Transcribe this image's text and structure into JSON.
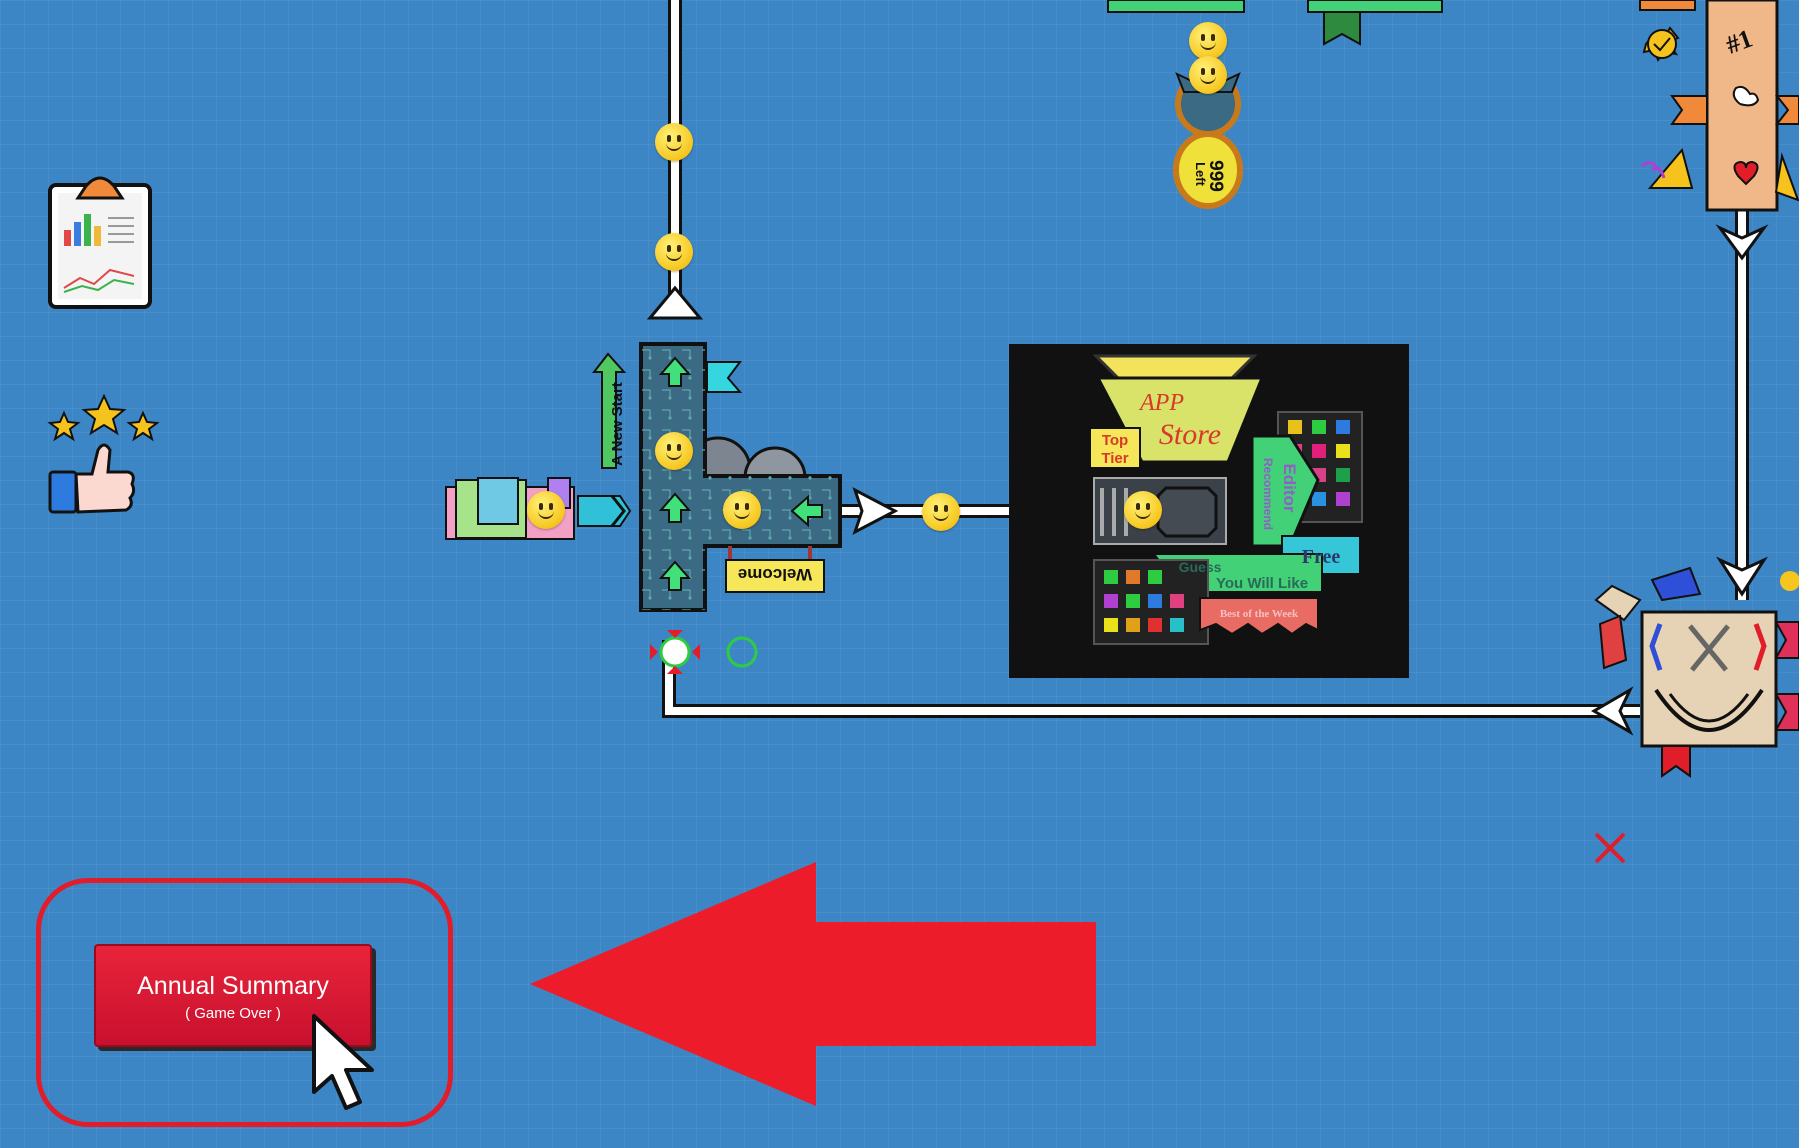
{
  "summary_button": {
    "title": "Annual Summary",
    "subtitle": "( Game Over )"
  },
  "app_store": {
    "name_line1": "APP",
    "name_line2": "Store",
    "tag_top_tier_1": "Top",
    "tag_top_tier_2": "Tier",
    "tag_editor": "Editor",
    "tag_recommend": "Recommend",
    "tag_free": "Free",
    "tag_guess": "Guess",
    "tag_you_will_like": "You Will Like",
    "tag_best_week": "Best of the Week"
  },
  "hub": {
    "new_start_label": "A New Start",
    "welcome_label": "Welcome"
  },
  "counter": {
    "value": "999",
    "unit": "Left"
  },
  "ranking": {
    "label": "#1"
  },
  "icons": [
    "report-clipboard-icon",
    "rating-stars-thumbs-up-icon",
    "cursor-pointer-icon",
    "close-x-icon",
    "arena-icon"
  ],
  "colors": {
    "background": "#3d86c6",
    "accent_red": "#e11d2a",
    "button_red": "#c8102e",
    "path": "#ffffff",
    "store_bg": "#111111"
  }
}
